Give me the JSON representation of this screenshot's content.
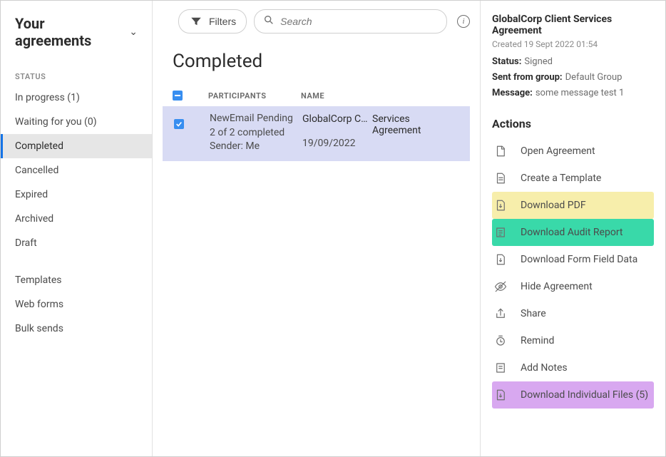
{
  "sidebar": {
    "title": "Your agreements",
    "status_label": "STATUS",
    "items": [
      {
        "label": "In progress (1)"
      },
      {
        "label": "Waiting for you (0)"
      },
      {
        "label": "Completed"
      },
      {
        "label": "Cancelled"
      },
      {
        "label": "Expired"
      },
      {
        "label": "Archived"
      },
      {
        "label": "Draft"
      }
    ],
    "secondary": [
      {
        "label": "Templates"
      },
      {
        "label": "Web forms"
      },
      {
        "label": "Bulk sends"
      }
    ]
  },
  "toolbar": {
    "filters_label": "Filters",
    "search_placeholder": "Search"
  },
  "main": {
    "section_title": "Completed",
    "headers": {
      "participants": "PARTICIPANTS",
      "name": "NAME"
    },
    "rows": [
      {
        "participant_line1": "NewEmail Pending",
        "participant_line2": "2 of 2 completed",
        "participant_line3": "Sender: Me",
        "name_truncated": "GlobalCorp Cli…",
        "name_extra": "Services Agreement",
        "date": "19/09/2022"
      }
    ]
  },
  "detail": {
    "title": "GlobalCorp Client Services Agreement",
    "created_label": "Created",
    "created_value": "19 Sept 2022 01:54",
    "status_label": "Status:",
    "status_value": "Signed",
    "group_label": "Sent from group:",
    "group_value": "Default Group",
    "message_label": "Message:",
    "message_value": "some message test 1",
    "actions_heading": "Actions",
    "actions": {
      "open": "Open Agreement",
      "create_template": "Create a Template",
      "download_pdf": "Download PDF",
      "download_audit": "Download Audit Report",
      "download_form": "Download Form Field Data",
      "hide": "Hide Agreement",
      "share": "Share",
      "remind": "Remind",
      "add_notes": "Add Notes",
      "download_individual": "Download Individual Files (5)"
    }
  }
}
